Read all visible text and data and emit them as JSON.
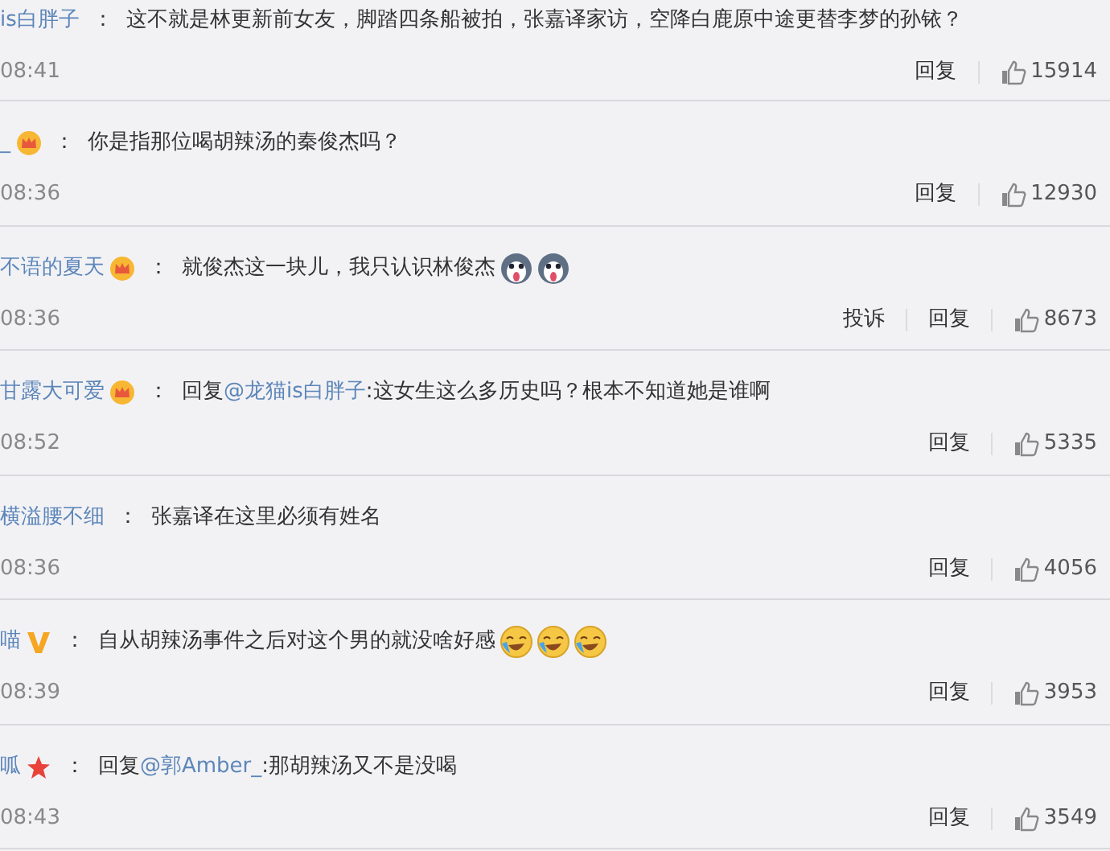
{
  "comments": [
    {
      "user": "is白胖子",
      "colon": "：",
      "text": "这不就是林更新前女友，脚踏四条船被拍，张嘉译家访，空降白鹿原中途更替李梦的孙铱？",
      "time": "08:41",
      "reply": "回复",
      "likes": "15914"
    },
    {
      "user": "_",
      "badge": {
        "kind": "crown"
      },
      "colon": "：",
      "text": "你是指那位喝胡辣汤的秦俊杰吗？",
      "time": "08:36",
      "reply": "回复",
      "likes": "12930"
    },
    {
      "user": "不语的夏天",
      "badge": {
        "kind": "crown"
      },
      "colon": "：",
      "text": "就俊杰这一块儿，我只认识林俊杰",
      "emojis": [
        {
          "kind": "husky"
        },
        {
          "kind": "husky"
        }
      ],
      "time": "08:36",
      "report": "投诉",
      "reply": "回复",
      "likes": "8673"
    },
    {
      "user": "甘露大可爱",
      "badge": {
        "kind": "crown"
      },
      "colon": "：",
      "reply_prefix": "回复",
      "mention": "@龙猫is白胖子",
      "text": ":这女生这么多历史吗？根本不知道她是谁啊",
      "time": "08:52",
      "reply": "回复",
      "likes": "5335"
    },
    {
      "user": "横溢腰不细",
      "colon": "：",
      "text": "张嘉译在这里必须有姓名",
      "time": "08:36",
      "reply": "回复",
      "likes": "4056"
    },
    {
      "user": "喵",
      "badge": {
        "kind": "vip"
      },
      "colon": "：",
      "text": "自从胡辣汤事件之后对这个男的就没啥好感",
      "emojis": [
        {
          "kind": "laugh-cry"
        },
        {
          "kind": "laugh-cry"
        },
        {
          "kind": "laugh-cry"
        }
      ],
      "time": "08:39",
      "reply": "回复",
      "likes": "3953"
    },
    {
      "user": "呱",
      "badge": {
        "kind": "star"
      },
      "colon": "：",
      "reply_prefix": "回复",
      "mention": "@郭Amber_",
      "text": ":那胡辣汤又不是没喝",
      "time": "08:43",
      "reply": "回复",
      "likes": "3549"
    }
  ]
}
